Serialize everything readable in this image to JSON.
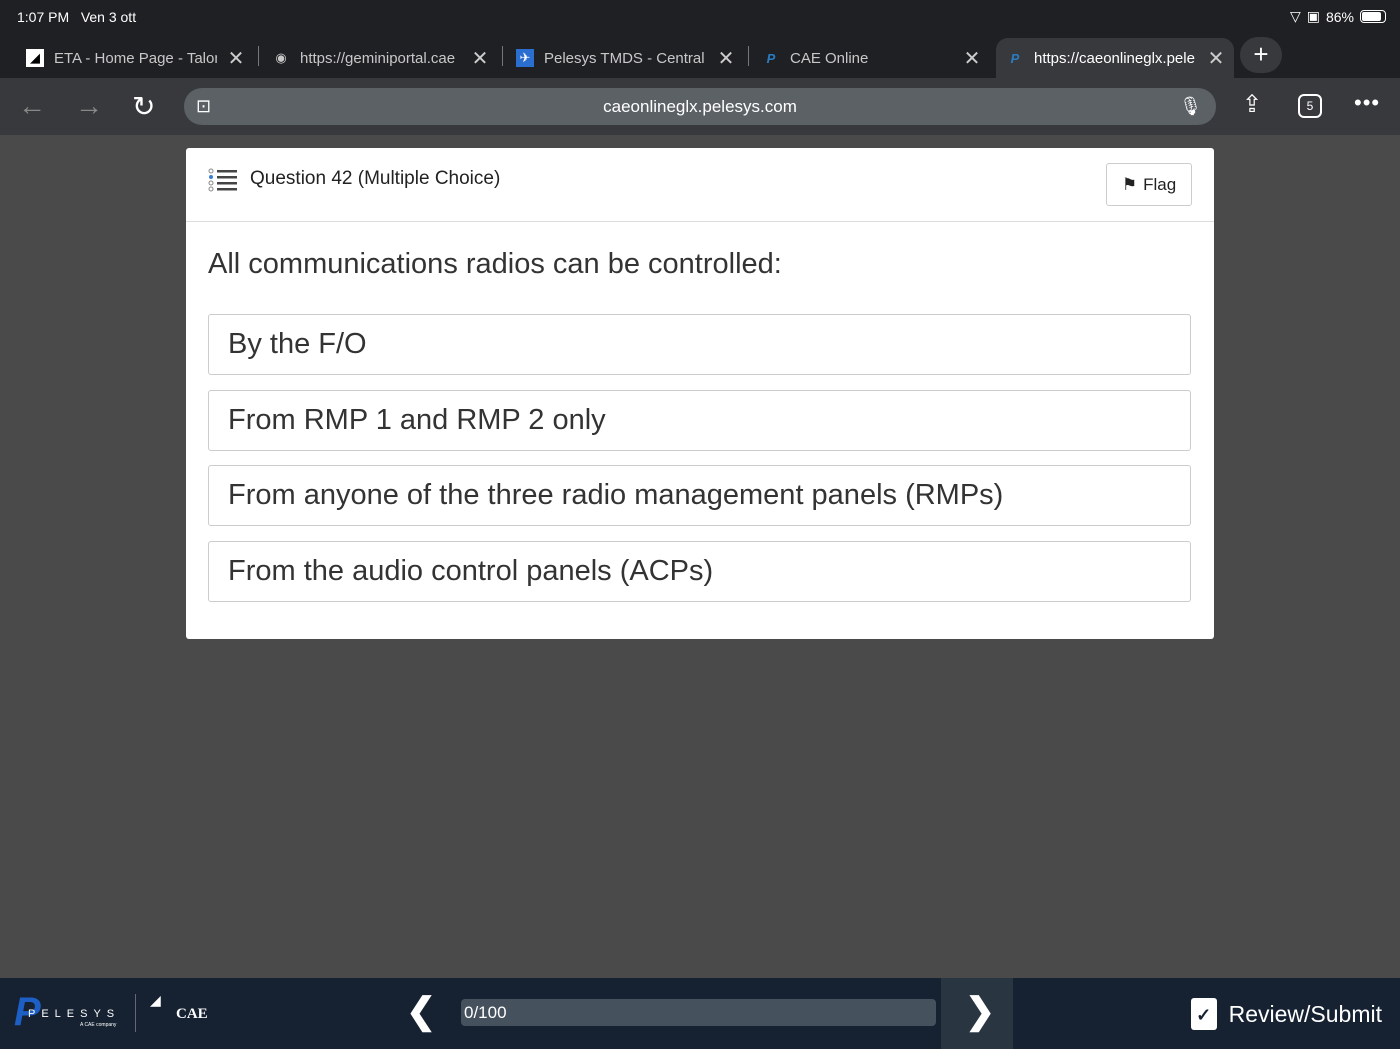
{
  "status": {
    "time": "1:07 PM",
    "date": "Ven 3 ott",
    "battery": "86%"
  },
  "tabs": [
    {
      "label": "ETA - Home Page - Talon",
      "active": false
    },
    {
      "label": "https://geminiportal.cae",
      "active": false
    },
    {
      "label": "Pelesys TMDS - Central",
      "active": false
    },
    {
      "label": "CAE Online",
      "active": false
    },
    {
      "label": "https://caeonlineglx.pele",
      "active": true
    }
  ],
  "toolbar": {
    "url": "caeonlineglx.pelesys.com",
    "tab_count": "5"
  },
  "question": {
    "title": "Question 42 (Multiple Choice)",
    "flag_label": "Flag",
    "text": "All communications radios can be controlled:",
    "options": [
      "By the F/O",
      "From RMP 1 and RMP 2 only",
      "From anyone of the three radio management panels (RMPs)",
      "From the audio control panels (ACPs)"
    ]
  },
  "footer": {
    "progress": "0/100",
    "progress_fraction": 0,
    "review_label": "Review/Submit",
    "logo_pelesys": "PELESYS",
    "logo_tagline": "A CAE company",
    "logo_cae": "CAE"
  }
}
